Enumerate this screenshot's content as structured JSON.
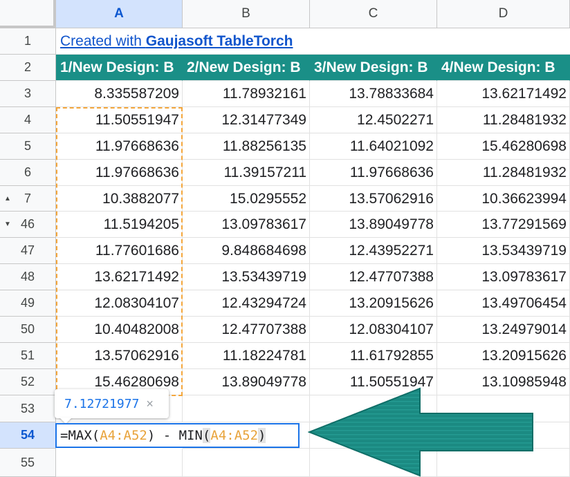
{
  "columns": [
    "A",
    "B",
    "C",
    "D"
  ],
  "row_numbers": [
    "1",
    "2",
    "3",
    "4",
    "5",
    "6",
    "7",
    "46",
    "47",
    "48",
    "49",
    "50",
    "51",
    "52",
    "53",
    "54",
    "55"
  ],
  "link_text": {
    "prefix": "Created with ",
    "brand": "Gaujasoft TableTorch"
  },
  "headers": [
    "1/New Design: B",
    "2/New Design: B",
    "3/New Design: B",
    "4/New Design: B"
  ],
  "rows": [
    [
      "8.335587209",
      "11.78932161",
      "13.78833684",
      "13.62171492"
    ],
    [
      "11.50551947",
      "12.31477349",
      "12.4502271",
      "11.28481932"
    ],
    [
      "11.97668636",
      "11.88256135",
      "11.64021092",
      "15.46280698"
    ],
    [
      "11.97668636",
      "11.39157211",
      "11.97668636",
      "11.28481932"
    ],
    [
      "10.3882077",
      "15.0295552",
      "13.57062916",
      "10.36623994"
    ],
    [
      "11.5194205",
      "13.09783617",
      "13.89049778",
      "13.77291569"
    ],
    [
      "11.77601686",
      "9.848684698",
      "12.43952271",
      "13.53439719"
    ],
    [
      "13.62171492",
      "13.53439719",
      "12.47707388",
      "13.09783617"
    ],
    [
      "12.08304107",
      "12.43294724",
      "13.20915626",
      "13.49706454"
    ],
    [
      "10.40482008",
      "12.47707388",
      "12.08304107",
      "13.24979014"
    ],
    [
      "13.57062916",
      "11.18224781",
      "11.61792855",
      "13.20915626"
    ],
    [
      "15.46280698",
      "13.89049778",
      "11.50551947",
      "13.10985948"
    ]
  ],
  "tooltip": {
    "value": "7.12721977",
    "close": "×"
  },
  "formula": {
    "p1": "=MAX(",
    "r1": "A4:A52",
    "p2": ") - MIN",
    "p3": "(",
    "r2": "A4:A52",
    "p4": ")"
  },
  "colors": {
    "header_fill": "#1a8f87",
    "reference": "#e8a33b",
    "selection": "#1a73e8",
    "arrow": "#1b8a82"
  },
  "icons": {
    "row7_toggle": "triangle-up-icon",
    "row46_toggle": "triangle-down-icon"
  }
}
